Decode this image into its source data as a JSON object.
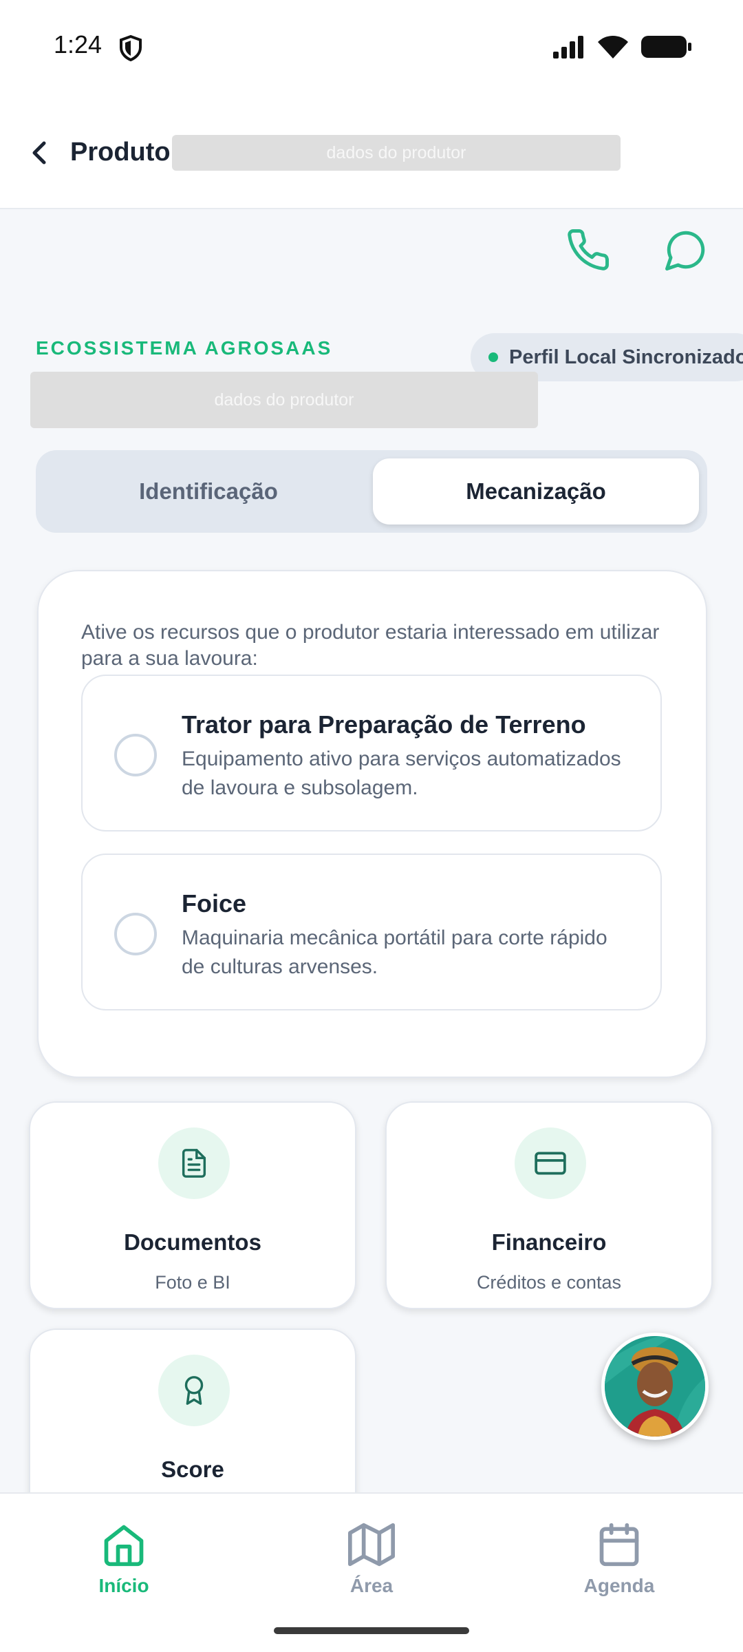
{
  "status_bar": {
    "time": "1:24"
  },
  "app_bar": {
    "title": "Produtor",
    "redacted_label": "dados do produtor"
  },
  "header": {
    "ecosystem_label": "ECOSSISTEMA AGROSAAS",
    "redacted_label": "dados do produtor",
    "sync_badge": "Perfil Local Sincronizado"
  },
  "tabs": [
    {
      "label": "Identificação",
      "active": false
    },
    {
      "label": "Mecanização",
      "active": true
    }
  ],
  "mechanization": {
    "instruction": "Ative os recursos que o produtor estaria interessado em utilizar para a sua lavoura:",
    "options": [
      {
        "title": "Trator para Preparação de Terreno",
        "description": "Equipamento ativo para serviços automatizados de lavoura e subsolagem.",
        "selected": false
      },
      {
        "title": "Foice",
        "description": "Maquinaria mecânica portátil para corte rápido de culturas arvenses.",
        "selected": false
      }
    ]
  },
  "features": [
    {
      "title": "Documentos",
      "subtitle": "Foto e BI",
      "icon": "document-icon"
    },
    {
      "title": "Financeiro",
      "subtitle": "Créditos e contas",
      "icon": "credit-card-icon"
    },
    {
      "title": "Score",
      "icon": "award-icon"
    }
  ],
  "bottom_nav": [
    {
      "label": "Início",
      "icon": "home-icon",
      "active": true
    },
    {
      "label": "Área",
      "icon": "map-icon",
      "active": false
    },
    {
      "label": "Agenda",
      "icon": "calendar-icon",
      "active": false
    }
  ],
  "colors": {
    "accent": "#19b97a",
    "inactive": "#8f9aab",
    "text": "#1b2433",
    "muted": "#5b6677"
  }
}
